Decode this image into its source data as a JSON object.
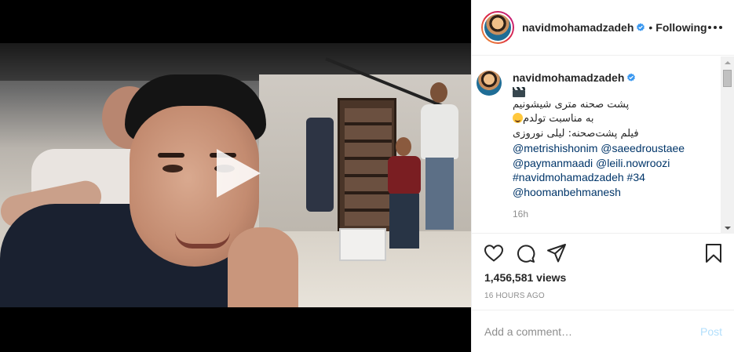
{
  "header": {
    "username": "navidmohamadzadeh",
    "separator": "•",
    "follow_status": "Following",
    "verified": true,
    "more_icon": "more-horizontal-icon"
  },
  "caption": {
    "username": "navidmohamadzadeh",
    "line1": "پشت صحنه متری شیشونیم",
    "line2": "به مناسبت تولدم",
    "line3": "فیلم پشت‌صحنه: لیلی نوروزی",
    "mentions1": "@metrishishonim @saeedroustaee",
    "mentions2": "@paymanmaadi @leili.nowroozi",
    "tags": "#navidmohamadzadeh #34",
    "mentions3": "@hoomanbehmanesh",
    "time": "16h"
  },
  "post": {
    "views": "1,456,581 views",
    "time_ago": "16 HOURS AGO"
  },
  "comment": {
    "placeholder": "Add a comment…",
    "post_label": "Post"
  },
  "colors": {
    "verified": "#3897f0",
    "link": "#003569",
    "post_disabled": "#b2dffc"
  }
}
